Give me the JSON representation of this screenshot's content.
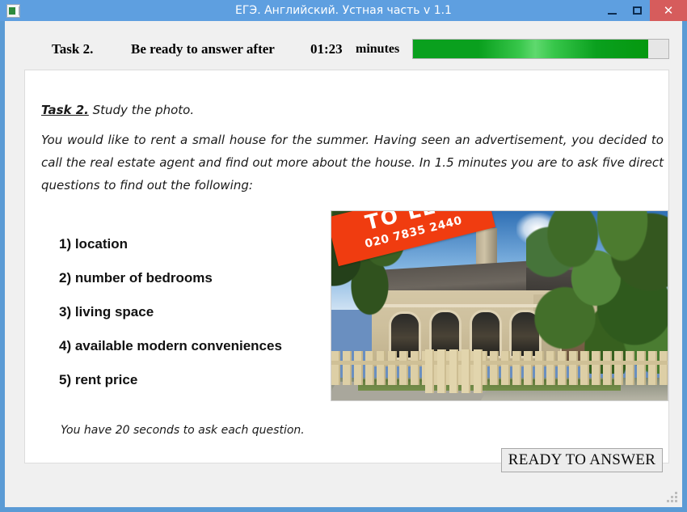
{
  "window": {
    "title": "ЕГЭ. Английский. Устная часть v 1.1",
    "app_icon": "app-window-icon",
    "minimize_label": "−",
    "maximize_label": "□",
    "close_label": "✕",
    "accent_color": "#5e9fe0",
    "close_color": "#d65c5c"
  },
  "header": {
    "task_label": "Task 2.",
    "status_label": "Be ready to answer after",
    "timer": "01:23",
    "units_label": "minutes",
    "progress_percent": 92,
    "progress_color": "#0aa01e"
  },
  "content": {
    "task_tag": "Task 2.",
    "task_instruction": "Study the photo.",
    "prompt": "You would like to rent a small house for the summer. Having seen an advertisement, you decided to call the real estate agent and find out more about the house. In 1.5 minutes you are to ask five direct questions to find out the following:",
    "questions": [
      "1) location",
      "2) number of bedrooms",
      "3) living space",
      "4) available modern conveniences",
      "5) rent price"
    ],
    "footnote": "You have 20 seconds to ask each question."
  },
  "photo": {
    "alt": "Photo of a single-storey cream brick house with arched windows, dark roof, wooden picket fence and trees",
    "sign_title": "TO LET",
    "sign_phone": "020 7835 2440",
    "sign_color": "#f03c10"
  },
  "footer": {
    "ready_button_label": "READY TO ANSWER"
  }
}
